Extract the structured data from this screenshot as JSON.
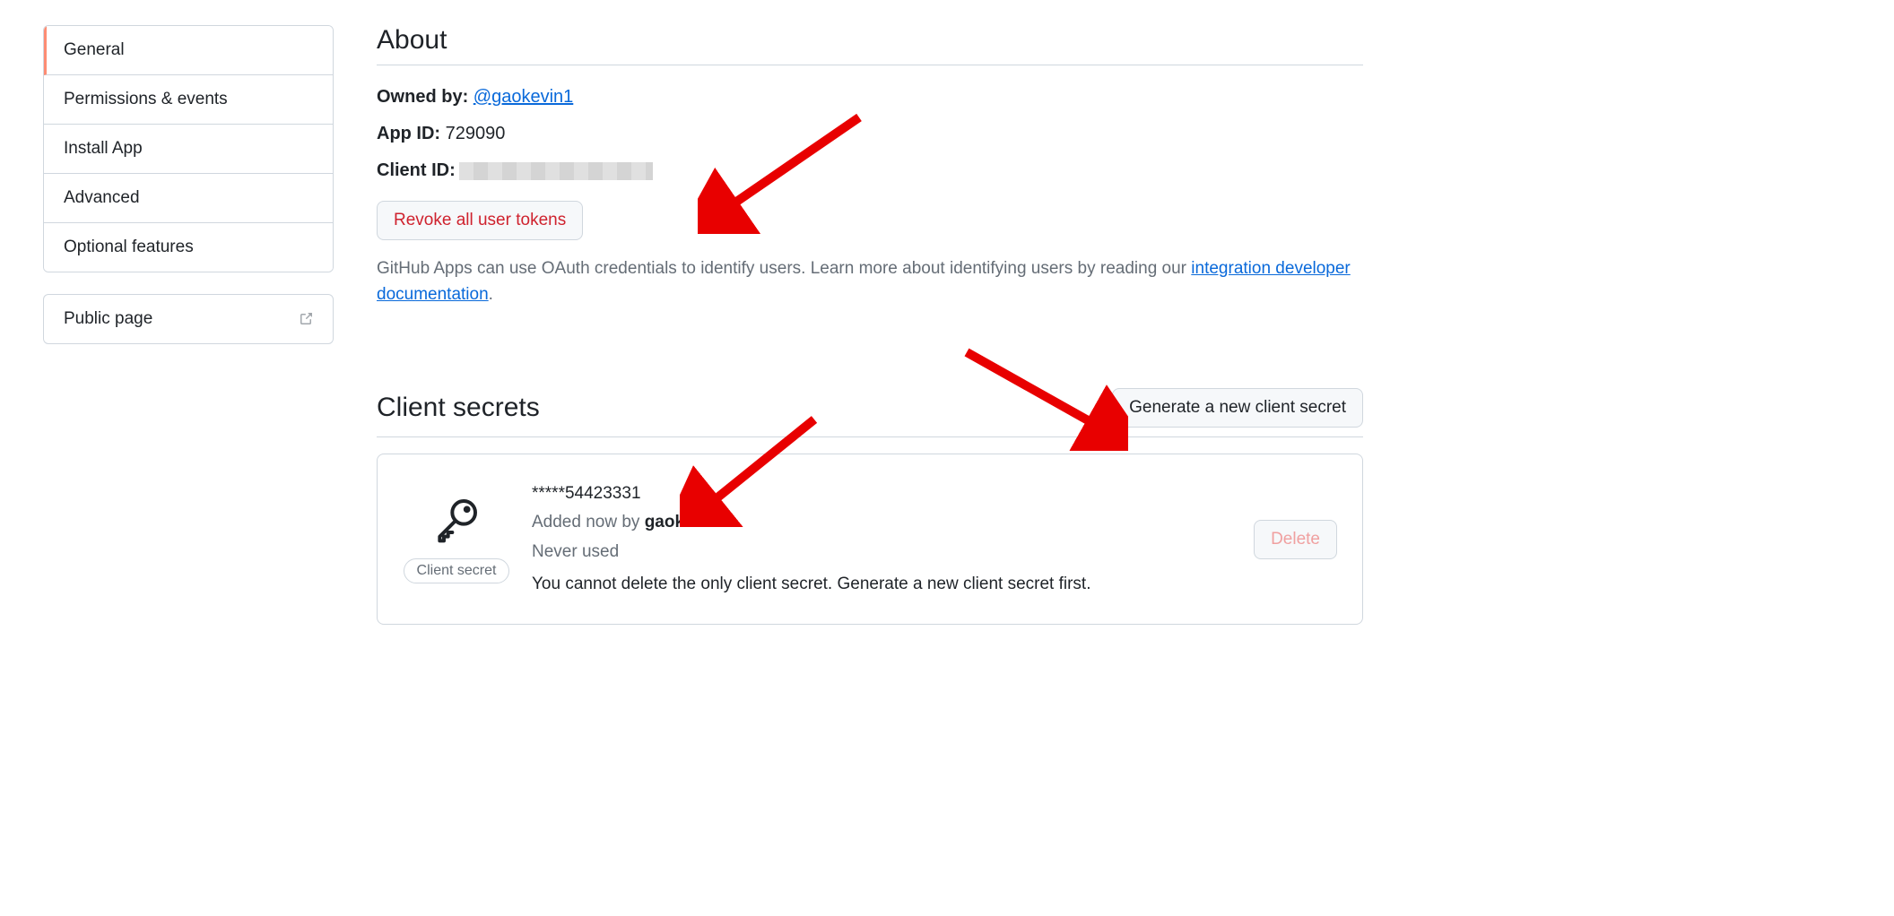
{
  "sidebar": {
    "items": [
      {
        "label": "General",
        "active": true
      },
      {
        "label": "Permissions & events",
        "active": false
      },
      {
        "label": "Install App",
        "active": false
      },
      {
        "label": "Advanced",
        "active": false
      },
      {
        "label": "Optional features",
        "active": false
      }
    ],
    "public_page_label": "Public page"
  },
  "about": {
    "heading": "About",
    "owned_by_label": "Owned by: ",
    "owner_handle": "@gaokevin1",
    "app_id_label": "App ID: ",
    "app_id_value": "729090",
    "client_id_label": "Client ID:",
    "revoke_button": "Revoke all user tokens",
    "help_prefix": "GitHub Apps can use OAuth credentials to identify users. Learn more about identifying users by reading our ",
    "help_link": "integration developer documentation",
    "help_suffix": "."
  },
  "secrets": {
    "heading": "Client secrets",
    "generate_button": "Generate a new client secret",
    "pill_label": "Client secret",
    "secret_value": "*****54423331",
    "added_prefix": "Added now by ",
    "added_by": "gaokevin1",
    "used_status": "Never used",
    "note": "You cannot delete the only client secret. Generate a new client secret first.",
    "delete_button": "Delete"
  }
}
